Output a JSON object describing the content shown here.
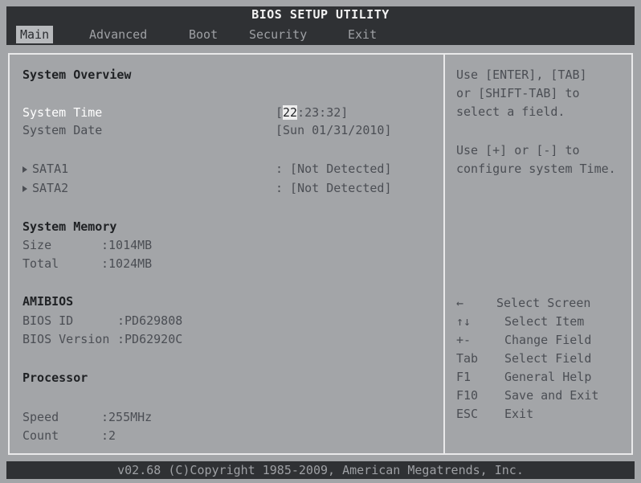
{
  "title": "BIOS SETUP UTILITY",
  "tabs": [
    {
      "label": "Main"
    },
    {
      "label": "Advanced"
    },
    {
      "label": "Boot"
    },
    {
      "label": "Security"
    },
    {
      "label": "Exit"
    }
  ],
  "overview": {
    "heading": "System Overview",
    "time_label": "System Time",
    "time_value_open": "[",
    "time_value_hour": "22",
    "time_value_rest": ":23:32]",
    "date_label": "System Date",
    "date_value": "[Sun 01/31/2010]",
    "sata1_label": "SATA1",
    "sata1_value": ": [Not Detected]",
    "sata2_label": "SATA2",
    "sata2_value": ": [Not Detected]"
  },
  "memory": {
    "heading": "System Memory",
    "size_label": "Size",
    "size_value": ":1014MB",
    "total_label": "Total",
    "total_value": ":1024MB"
  },
  "amibios": {
    "heading": "AMIBIOS",
    "id_label": "BIOS ID",
    "id_value": ":PD629808",
    "version_label": "BIOS Version",
    "version_value": ":PD62920C"
  },
  "processor": {
    "heading": "Processor",
    "speed_label": "Speed",
    "speed_value": ":255MHz",
    "count_label": "Count",
    "count_value": ":2"
  },
  "help": {
    "line1": "Use [ENTER], [TAB]",
    "line2": "or [SHIFT-TAB] to",
    "line3": "select a field.",
    "line4": "Use [+] or [-] to",
    "line5": "configure system Time."
  },
  "keys": [
    {
      "key": "←",
      "desc": "Select Screen"
    },
    {
      "key": "↑↓",
      "desc": "Select Item"
    },
    {
      "key": "+-",
      "desc": "Change Field"
    },
    {
      "key": "Tab",
      "desc": "Select Field"
    },
    {
      "key": "F1",
      "desc": "General Help"
    },
    {
      "key": "F10",
      "desc": "Save and Exit"
    },
    {
      "key": "ESC",
      "desc": "Exit"
    }
  ],
  "footer": "v02.68 (C)Copyright 1985-2009, American Megatrends, Inc."
}
